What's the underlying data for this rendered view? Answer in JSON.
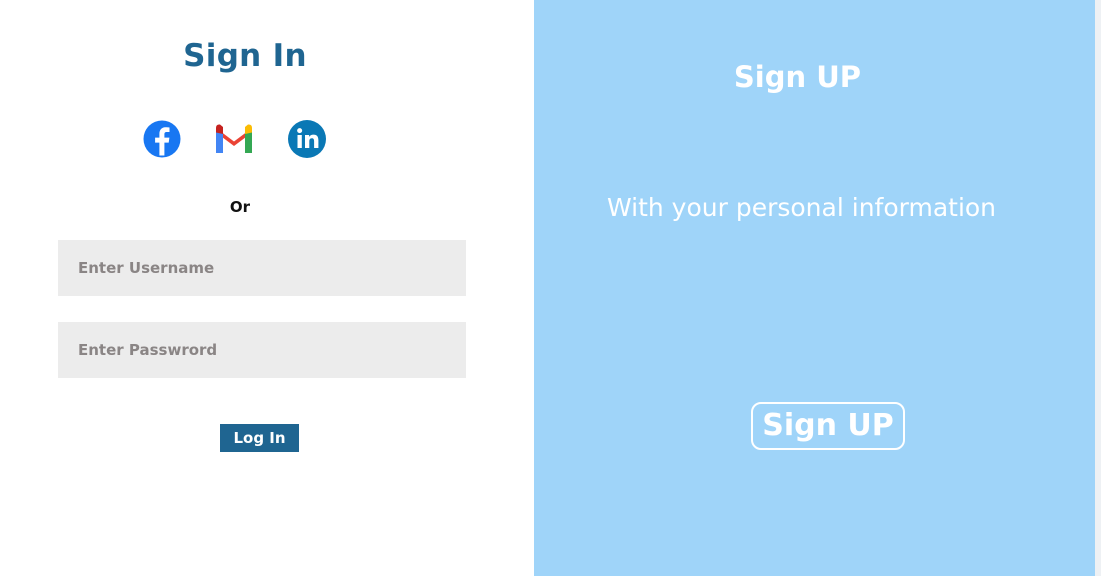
{
  "signin": {
    "title": "Sign In",
    "social_icons": [
      "facebook-icon",
      "gmail-icon",
      "linkedin-icon"
    ],
    "or_label": "Or",
    "username_placeholder": "Enter Username",
    "password_placeholder": "Enter Passwrord",
    "login_label": "Log In"
  },
  "signup": {
    "title": "Sign UP",
    "subtitle": "With your personal information",
    "button_label": "Sign UP"
  },
  "colors": {
    "primary": "#1f6591",
    "panel": "#9fd4f9",
    "field_bg": "#ececec",
    "facebook": "#1877f2",
    "linkedin": "#0a78b5"
  }
}
